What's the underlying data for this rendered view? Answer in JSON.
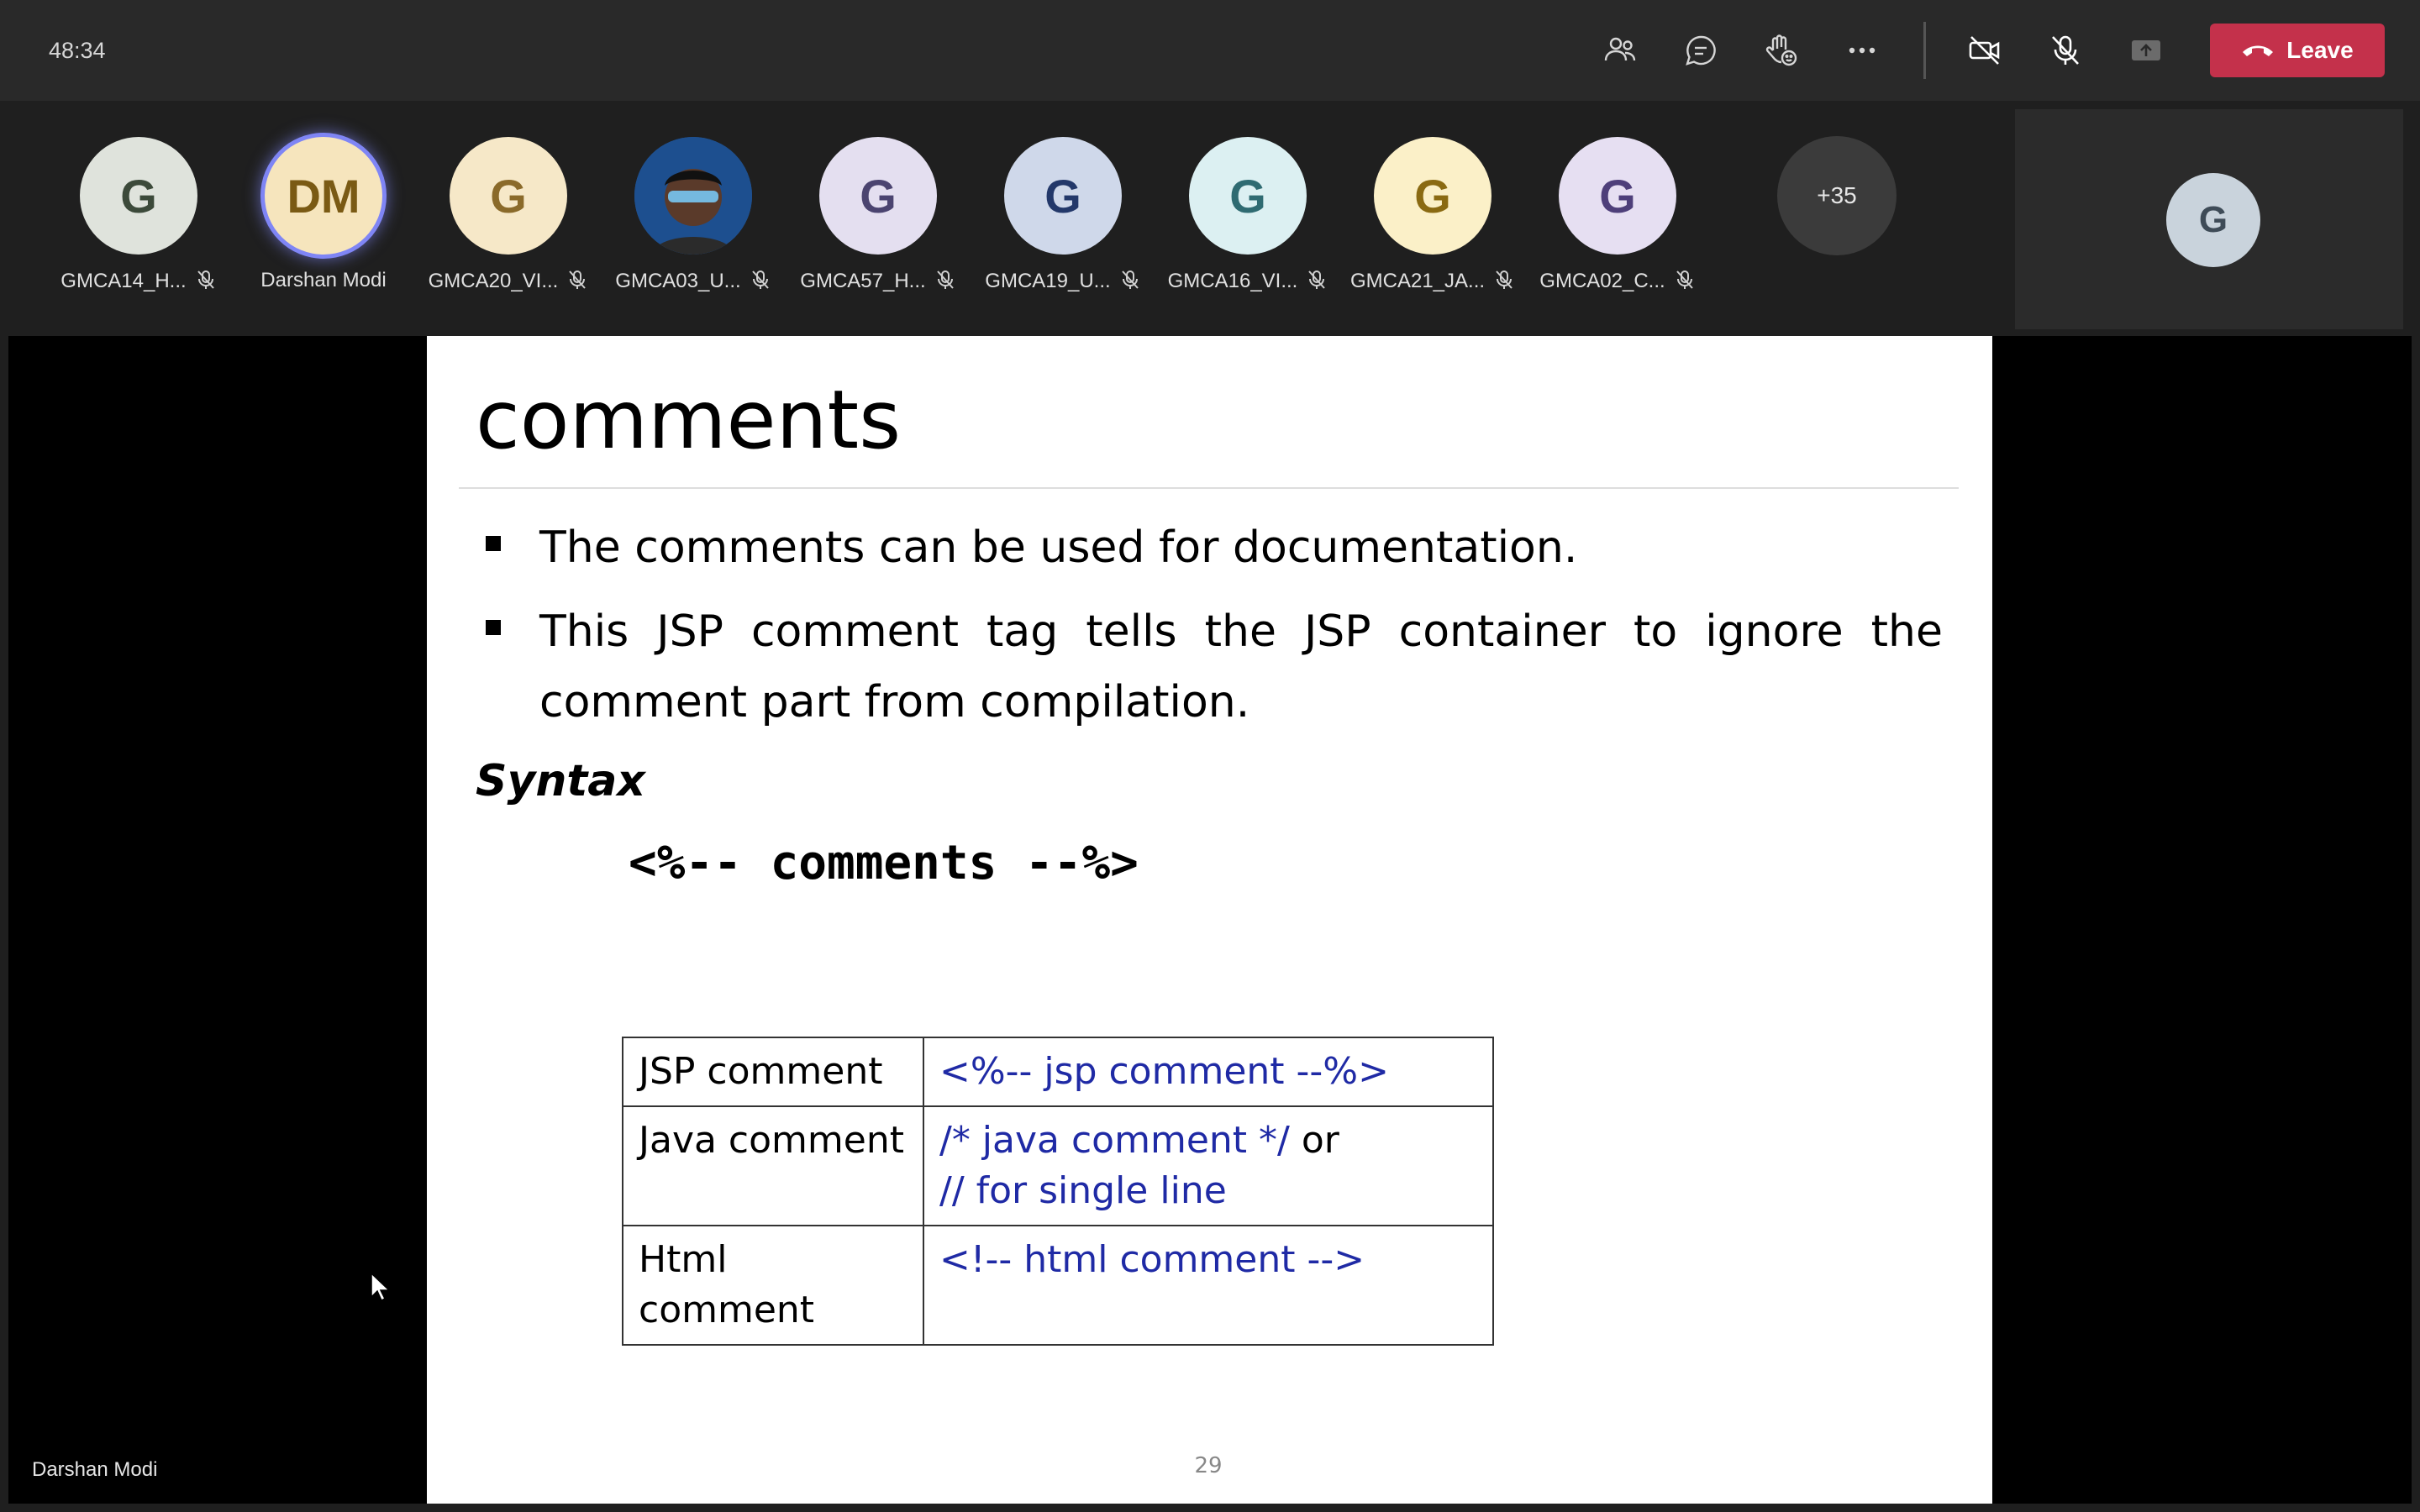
{
  "topbar": {
    "timer": "48:34",
    "icons": [
      "people-icon",
      "chat-icon",
      "raise-hand-icon",
      "more-icon",
      "camera-off-icon",
      "mic-off-icon",
      "share-icon"
    ],
    "leave_label": "Leave",
    "leave_color": "#c4314b"
  },
  "participants": [
    {
      "initials": "G",
      "name": "GMCA14_H...",
      "bg": "#dfe3dc",
      "fg": "#3c4a3a",
      "muted": true
    },
    {
      "initials": "DM",
      "name": "Darshan Modi",
      "bg": "#f6e5bd",
      "fg": "#7a5a14",
      "muted": false,
      "speaking": true
    },
    {
      "initials": "G",
      "name": "GMCA20_VI...",
      "bg": "#f6e8c8",
      "fg": "#8a6a2a",
      "muted": true
    },
    {
      "initials": "",
      "name": "GMCA03_U...",
      "bg": "#2a5a9a",
      "fg": "#ffffff",
      "muted": true,
      "photo": true
    },
    {
      "initials": "G",
      "name": "GMCA57_H...",
      "bg": "#e4dff0",
      "fg": "#4b4470",
      "muted": true
    },
    {
      "initials": "G",
      "name": "GMCA19_U...",
      "bg": "#cfd8ea",
      "fg": "#23386a",
      "muted": true
    },
    {
      "initials": "G",
      "name": "GMCA16_VI...",
      "bg": "#dcf0f2",
      "fg": "#2f6b72",
      "muted": true
    },
    {
      "initials": "G",
      "name": "GMCA21_JA...",
      "bg": "#fbf0c8",
      "fg": "#8a6a12",
      "muted": true
    },
    {
      "initials": "G",
      "name": "GMCA02_C...",
      "bg": "#e6dff2",
      "fg": "#4e3f7a",
      "muted": true
    }
  ],
  "more_participants": "+35",
  "self_avatar": "G",
  "slide": {
    "title": "comments",
    "bullet1": "The comments can be used for documentation.",
    "bullet2": "This JSP comment tag tells the JSP container to ignore the comment part from compilation.",
    "syntax_label": "Syntax",
    "code": "<%-- comments --%>",
    "table": [
      {
        "label": "JSP comment",
        "value": "<%--  jsp comment  --%>"
      },
      {
        "label": "Java comment",
        "value": "/*  java comment */",
        "or": "or",
        "value2": "//  for single line"
      },
      {
        "label": "Html comment",
        "value": "<!--  html comment  -->"
      }
    ],
    "page_number": "29"
  },
  "presenter": "Darshan Modi"
}
